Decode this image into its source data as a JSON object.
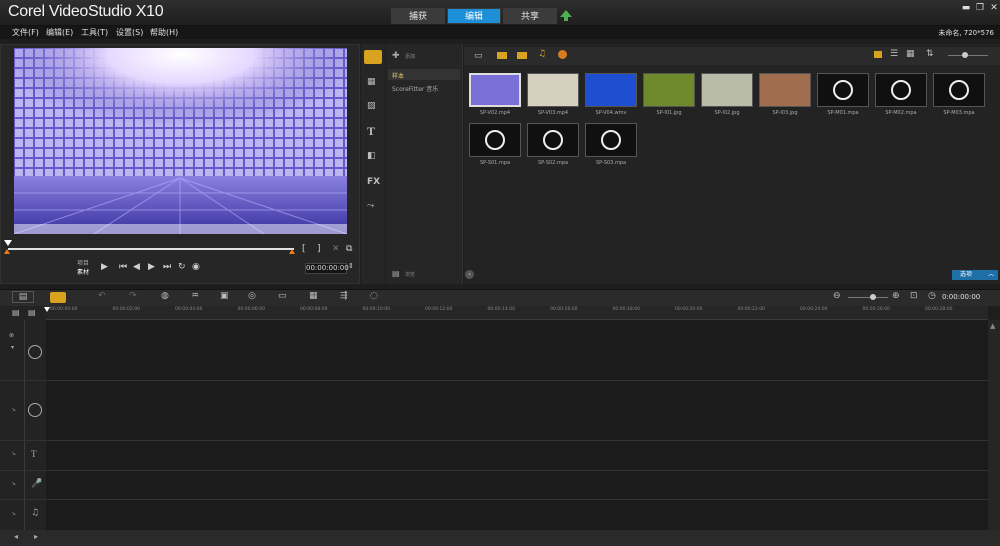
{
  "app": {
    "title": "Corel VideoStudio X10",
    "tabs": [
      "捕获",
      "编辑",
      "共享"
    ],
    "menus": [
      "文件(F)",
      "编辑(E)",
      "工具(T)",
      "设置(S)",
      "帮助(H)"
    ],
    "project_info": "未命名, 720*576"
  },
  "preview": {
    "mode_project": "项目",
    "mode_clip": "素材",
    "timecode": "00:00:00:00"
  },
  "library": {
    "add_label": "添加",
    "folders": [
      "样本",
      "ScoreFitter 音乐"
    ],
    "browse_label": "浏览",
    "options_label": "选项",
    "thumbnails": [
      {
        "name": "SP-V02.mp4",
        "kind": "video",
        "color": "#7a6fd6"
      },
      {
        "name": "SP-V03.mp4",
        "kind": "video",
        "color": "#d6d0c0"
      },
      {
        "name": "SP-V04.wmv",
        "kind": "video",
        "color": "#1f4fd0"
      },
      {
        "name": "SP-I01.jpg",
        "kind": "image",
        "color": "#6f8a2a"
      },
      {
        "name": "SP-I02.jpg",
        "kind": "image",
        "color": "#b8bca8"
      },
      {
        "name": "SP-I03.jpg",
        "kind": "image",
        "color": "#a06d4e"
      },
      {
        "name": "SP-M01.mpa",
        "kind": "audio",
        "color": "#101010"
      },
      {
        "name": "SP-M02.mpa",
        "kind": "audio",
        "color": "#101010"
      },
      {
        "name": "SP-M03.mpa",
        "kind": "audio",
        "color": "#101010"
      },
      {
        "name": "SP-S01.mpa",
        "kind": "audio",
        "color": "#101010"
      },
      {
        "name": "SP-S02.mpa",
        "kind": "audio",
        "color": "#101010"
      },
      {
        "name": "SP-S03.mpa",
        "kind": "audio",
        "color": "#101010"
      }
    ]
  },
  "timeline": {
    "duration": "0:00:00:00",
    "ruler_labels": [
      "00:00:00:00",
      "00:00:02:00",
      "00:00:04:00",
      "00:00:06:00",
      "00:00:08:00",
      "00:00:10:00",
      "00:00:12:00",
      "00:00:14:00",
      "00:00:16:00",
      "00:00:18:00",
      "00:00:20:00",
      "00:00:22:00",
      "00:00:24:00",
      "00:00:26:00",
      "00:00:28:00"
    ]
  },
  "colors": {
    "accent": "#1d8fd6",
    "share_arrow": "#4caf50"
  }
}
